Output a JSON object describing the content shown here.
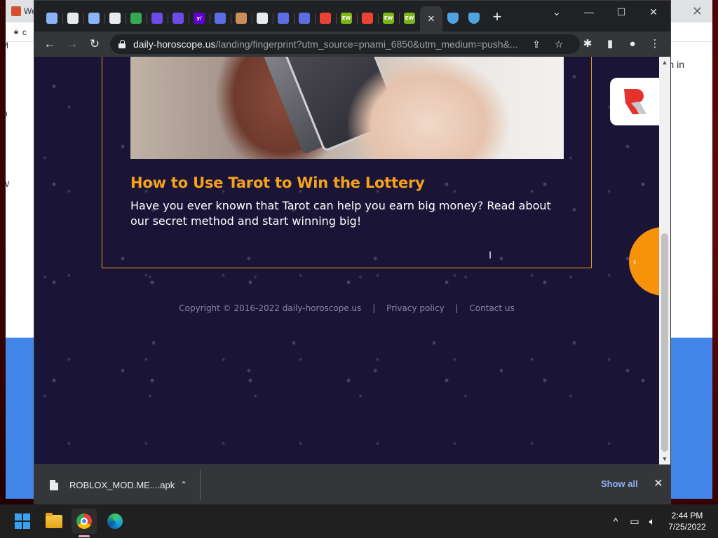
{
  "background_window": {
    "tab_title": "We",
    "side_text_m": "M",
    "side_text_d": "D",
    "side_text_w": "W",
    "address_initial": "c",
    "sign_in": "n in"
  },
  "browser": {
    "tabs": [
      {
        "icon": "globe-icon",
        "color": "#8ab4f8"
      },
      {
        "icon": "puzzle-icon",
        "color": "#e8eaed"
      },
      {
        "icon": "link-icon",
        "color": "#8ab4f8"
      },
      {
        "icon": "store-icon",
        "color": "#e8eaed"
      },
      {
        "icon": "meet-icon",
        "color": "#34a853"
      },
      {
        "icon": "app-icon",
        "color": "#6b4de6"
      },
      {
        "icon": "app-icon",
        "color": "#6b4de6"
      },
      {
        "icon": "yahoo-icon",
        "color": "#6001d2",
        "text": "y/"
      },
      {
        "icon": "layers-icon",
        "color": "#5b6ee1"
      },
      {
        "icon": "avatar-icon",
        "color": "#c98d5c"
      },
      {
        "icon": "store-icon",
        "color": "#e8eaed"
      },
      {
        "icon": "shield-icon",
        "color": "#5b6ee1"
      },
      {
        "icon": "shield-icon",
        "color": "#5b6ee1"
      },
      {
        "icon": "target-icon",
        "color": "#ea4335"
      },
      {
        "icon": "ew-icon",
        "color": "#7cb518",
        "text": "EW"
      },
      {
        "icon": "target-icon",
        "color": "#ea4335"
      },
      {
        "icon": "ew-icon",
        "color": "#7cb518",
        "text": "EW"
      },
      {
        "icon": "ew-icon",
        "color": "#7cb518",
        "text": "EW"
      }
    ],
    "active_tab_close": "✕",
    "after_tabs": [
      {
        "icon": "shield-blue-icon",
        "color": "#4fa3e0"
      },
      {
        "icon": "shield-blue-icon",
        "color": "#4fa3e0"
      }
    ],
    "new_tab": "+",
    "window_controls": {
      "dropdown": "⌄",
      "minimize": "—",
      "maximize": "☐",
      "close": "✕"
    },
    "toolbar": {
      "back": "←",
      "forward": "→",
      "reload": "↻"
    },
    "url_domain": "daily-horoscope.us",
    "url_path": "/landing/fingerprint?utm_source=pnami_6850&utm_medium=push&..."
  },
  "page": {
    "article": {
      "title": "How to Use Tarot to Win the Lottery",
      "description": "Have you ever known that Tarot can help you earn big money? Read about our secret method and start winning big!"
    },
    "footer": {
      "copyright": "Copyright © 2016-2022 daily-horoscope.us",
      "separator": "|",
      "privacy": "Privacy policy",
      "contact": "Contact us"
    },
    "side_tab_arrow": "‹"
  },
  "downloads": {
    "file_name": "ROBLOX_MOD.ME....apk",
    "chevron": "⌃",
    "show_all": "Show all",
    "close": "✕"
  },
  "taskbar": {
    "time": "2:44 PM",
    "date": "7/25/2022",
    "tray_chevron": "^"
  }
}
